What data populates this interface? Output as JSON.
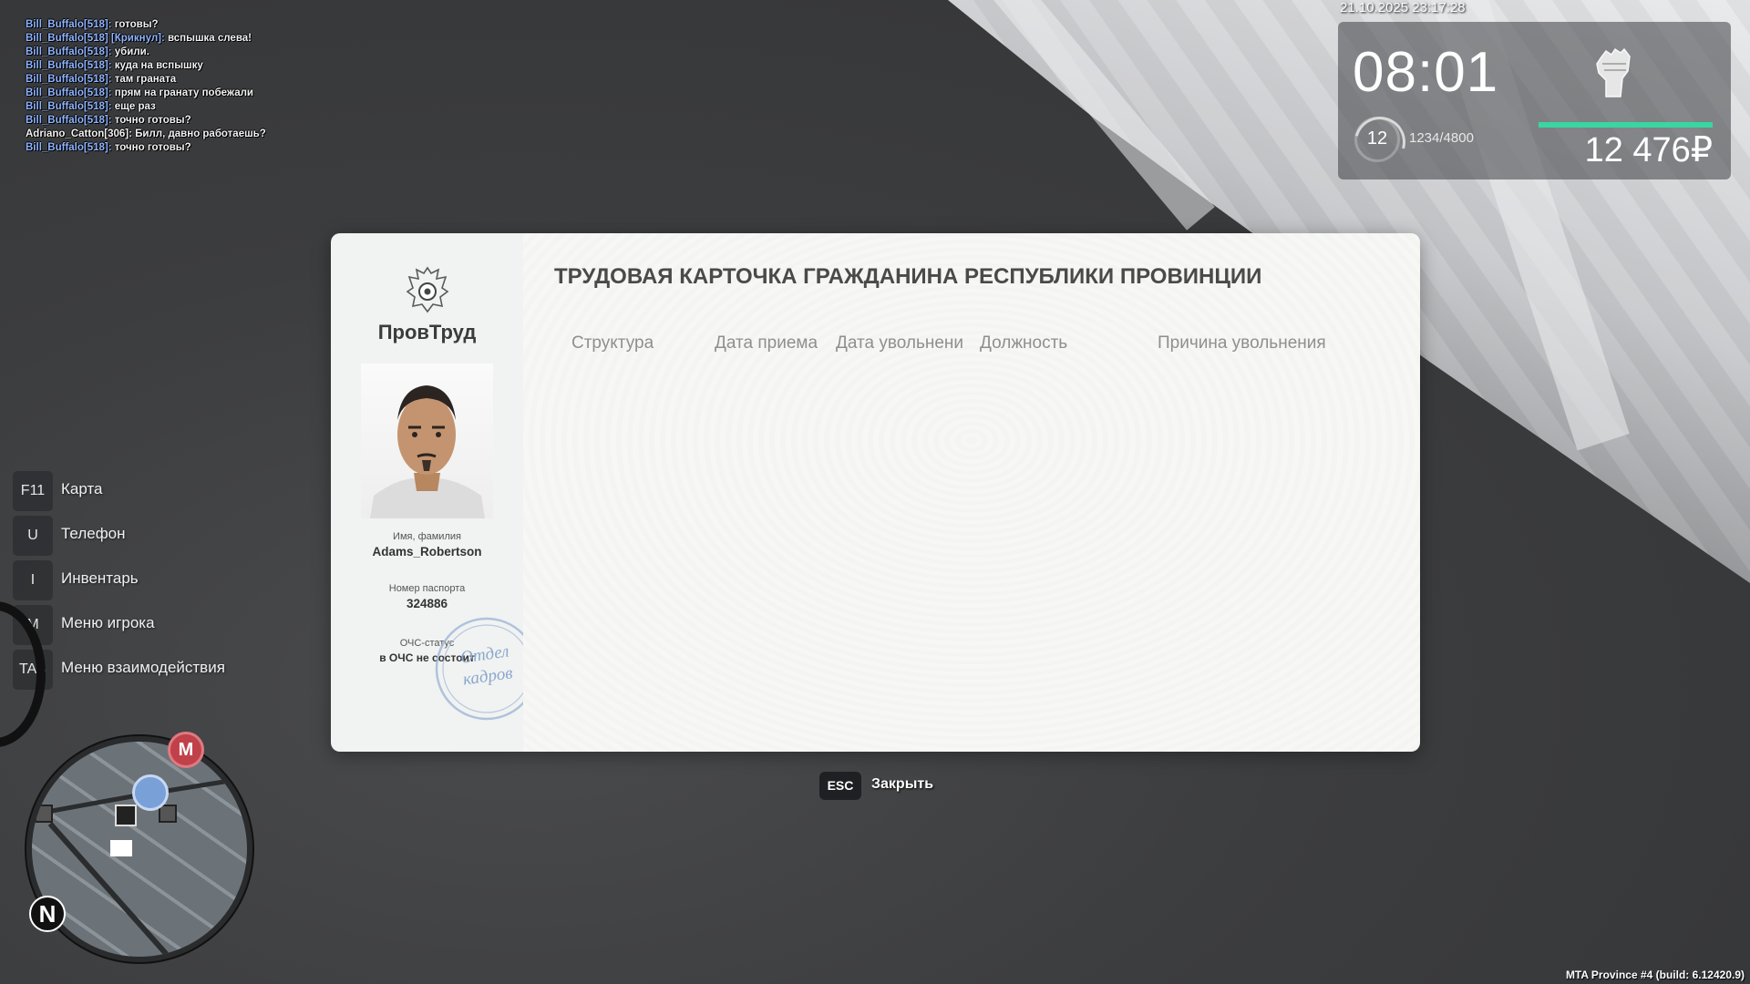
{
  "chat": [
    {
      "nick": "Bill_Buffalo[518]:",
      "msg": "готовы?",
      "nick_color": "blue"
    },
    {
      "nick": "Bill_Buffalo[518] [Крикнул]:",
      "msg": "вспышка слева!",
      "nick_color": "blue"
    },
    {
      "nick": "Bill_Buffalo[518]:",
      "msg": "убили.",
      "nick_color": "blue"
    },
    {
      "nick": "Bill_Buffalo[518]:",
      "msg": "куда на вспышку",
      "nick_color": "blue"
    },
    {
      "nick": "Bill_Buffalo[518]:",
      "msg": "там граната",
      "nick_color": "blue"
    },
    {
      "nick": "Bill_Buffalo[518]:",
      "msg": "прям на гранату побежали",
      "nick_color": "blue"
    },
    {
      "nick": "Bill_Buffalo[518]:",
      "msg": "еще раз",
      "nick_color": "blue"
    },
    {
      "nick": "Bill_Buffalo[518]:",
      "msg": "точно готовы?",
      "nick_color": "blue"
    },
    {
      "nick": "Adriano_Catton[306]:",
      "msg": "Билл, давно работаешь?",
      "nick_color": "white"
    },
    {
      "nick": "Bill_Buffalo[518]:",
      "msg": "точно готовы?",
      "nick_color": "blue"
    }
  ],
  "hud": {
    "datetime": "21.10.2025 23:17:28",
    "time": "08:01",
    "level": "12",
    "xp": "1234/4800",
    "money": "12 476₽",
    "bar_color": "#38d6a0",
    "icon": "fist-icon"
  },
  "card": {
    "org_name": "ПровТруд",
    "emblem": "coat-of-arms-icon",
    "name_label": "Имя, фамилия",
    "name_value": "Adams_Robertson",
    "passport_label": "Номер паспорта",
    "passport_value": "324886",
    "status_label": "ОЧС-статус",
    "status_value": "в ОЧС не состоит",
    "stamp_line1": "Отдел",
    "stamp_line2": "кадров",
    "title": "ТРУДОВАЯ КАРТОЧКА ГРАЖДАНИНА РЕСПУБЛИКИ ПРОВИНЦИИ",
    "columns": [
      "Структура",
      "Дата приема",
      "Дата увольнени",
      "Должность",
      "Причина увольнения"
    ],
    "rows": []
  },
  "close": {
    "key": "ESC",
    "label": "Закрыть"
  },
  "menu": [
    {
      "key": "F11",
      "label": "Карта"
    },
    {
      "key": "U",
      "label": "Телефон"
    },
    {
      "key": "I",
      "label": "Инвентарь"
    },
    {
      "key": "M",
      "label": "Меню игрока"
    },
    {
      "key": "TAB",
      "label": "Меню взаимодействия"
    }
  ],
  "minimap": {
    "metro_label": "M",
    "north_label": "N"
  },
  "build": "MTA Province #4 (build: 6.12420.9)"
}
